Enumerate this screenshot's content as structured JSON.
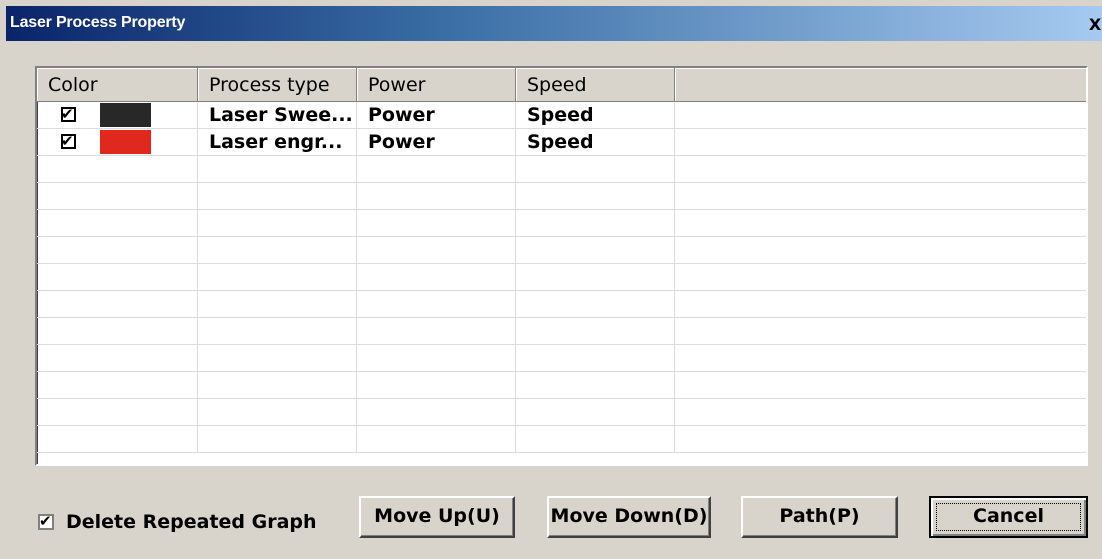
{
  "window": {
    "title": "Laser Process Property",
    "close_label": "X"
  },
  "grid": {
    "headers": [
      "Color",
      "Process type",
      "Power",
      "Speed",
      ""
    ],
    "rows": [
      {
        "checked": true,
        "color": "#282828",
        "process_type": "Laser Swee...",
        "power": "Power",
        "speed": "Speed"
      },
      {
        "checked": true,
        "color": "#e0281e",
        "process_type": "Laser engr...",
        "power": "Power",
        "speed": "Speed"
      }
    ],
    "empty_rows": 11
  },
  "options": {
    "delete_repeated_label": "Delete Repeated Graph",
    "delete_repeated_checked": true
  },
  "buttons": {
    "move_up": "Move Up(U)",
    "move_down": "Move Down(D)",
    "path": "Path(P)",
    "cancel": "Cancel"
  }
}
